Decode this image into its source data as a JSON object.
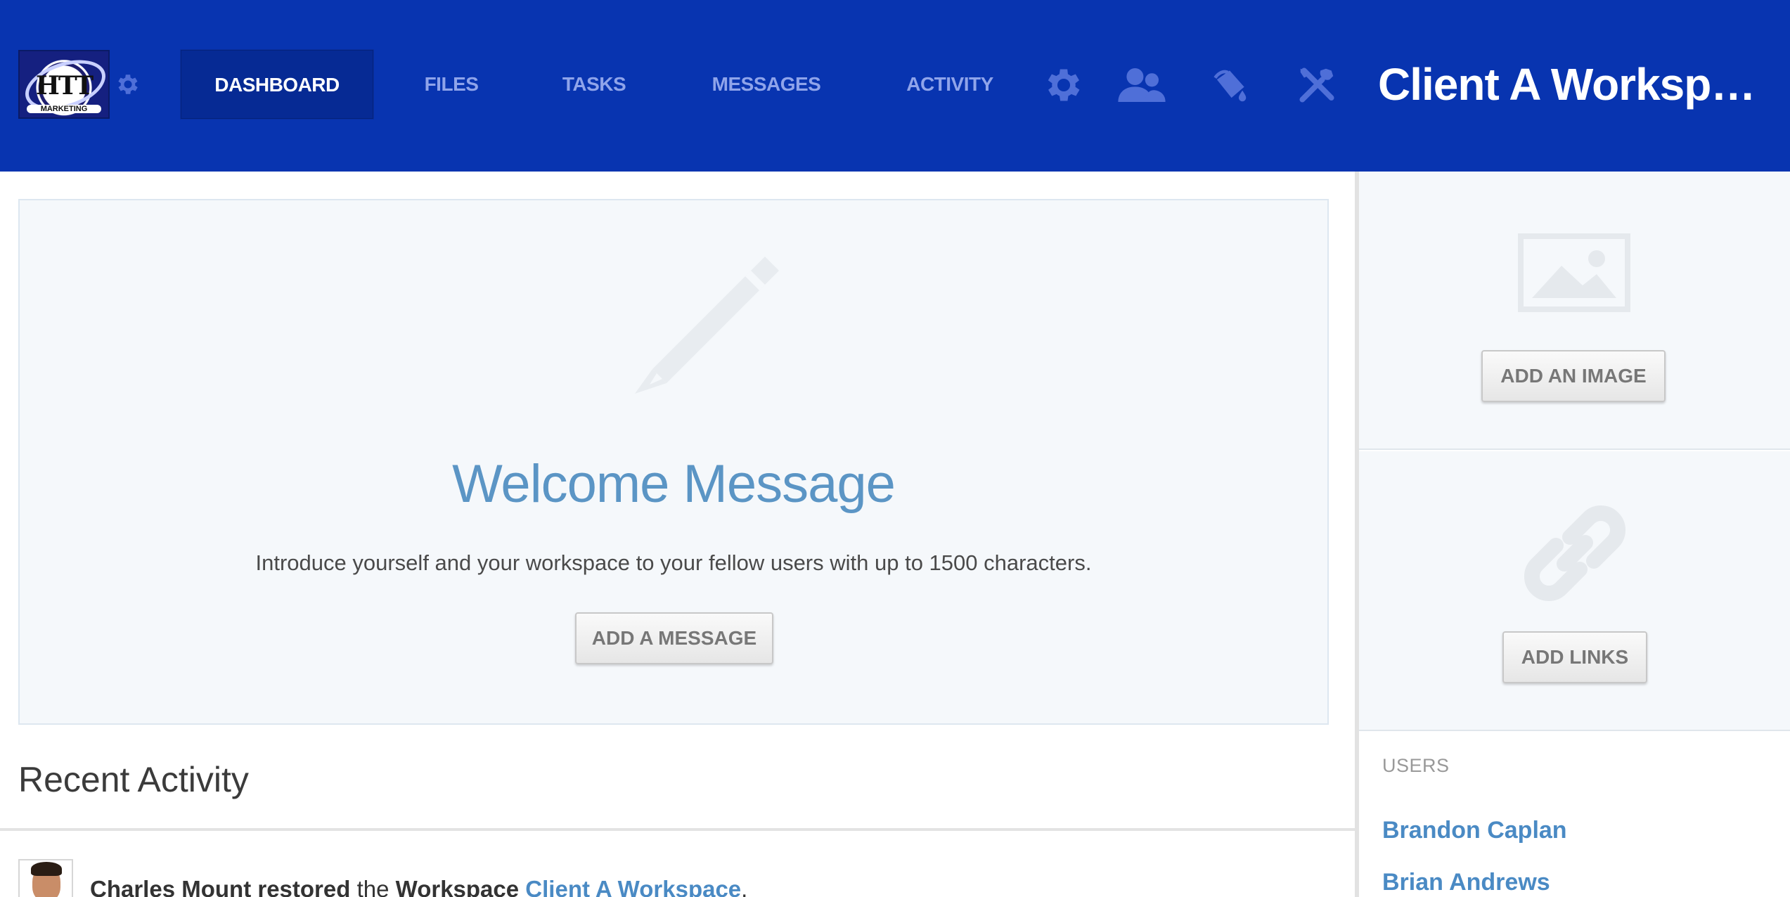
{
  "header": {
    "logo_text": "HTT",
    "logo_subtext": "MARKETING",
    "workspace_title": "Client A Worksp…",
    "nav": [
      {
        "label": "DASHBOARD",
        "active": true
      },
      {
        "label": "FILES",
        "active": false
      },
      {
        "label": "TASKS",
        "active": false
      },
      {
        "label": "MESSAGES",
        "active": false
      },
      {
        "label": "ACTIVITY",
        "active": false
      }
    ],
    "icons": [
      "gear-icon",
      "users-icon",
      "paint-bucket-icon",
      "tools-icon"
    ],
    "colors": {
      "bar": "#0834b0",
      "active_tab": "#062a94",
      "inactive_text": "#8fa4ea"
    }
  },
  "welcome": {
    "icon": "pencil-icon",
    "title": "Welcome Message",
    "description": "Introduce yourself and your workspace to your fellow users with up to 1500 characters.",
    "button_label": "ADD A MESSAGE"
  },
  "recent_activity": {
    "title": "Recent Activity",
    "items": [
      {
        "actor": "Charles Mount",
        "action": "restored",
        "connector": "the",
        "object_type": "Workspace",
        "object_name": "Client A Workspace",
        "punct": "."
      }
    ]
  },
  "sidebar": {
    "image_button_label": "ADD AN IMAGE",
    "links_button_label": "ADD LINKS",
    "users_label": "USERS",
    "users": [
      "Brandon Caplan",
      "Brian Andrews"
    ]
  }
}
